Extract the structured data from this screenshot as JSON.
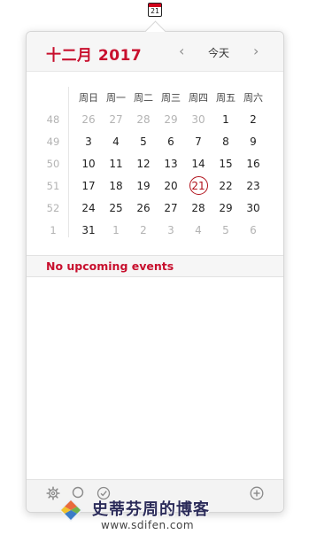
{
  "menubar": {
    "calendar_icon_day": "21"
  },
  "header": {
    "month_title": "十二月 2017",
    "prev_label": "‹",
    "next_label": "›",
    "today_label": "今天"
  },
  "calendar": {
    "weekdays": [
      "周日",
      "周一",
      "周二",
      "周三",
      "周四",
      "周五",
      "周六"
    ],
    "weeks": [
      {
        "week": "48",
        "days": [
          {
            "d": "26",
            "other": true
          },
          {
            "d": "27",
            "other": true
          },
          {
            "d": "28",
            "other": true
          },
          {
            "d": "29",
            "other": true
          },
          {
            "d": "30",
            "other": true
          },
          {
            "d": "1"
          },
          {
            "d": "2"
          }
        ]
      },
      {
        "week": "49",
        "days": [
          {
            "d": "3"
          },
          {
            "d": "4"
          },
          {
            "d": "5"
          },
          {
            "d": "6"
          },
          {
            "d": "7"
          },
          {
            "d": "8"
          },
          {
            "d": "9"
          }
        ]
      },
      {
        "week": "50",
        "days": [
          {
            "d": "10"
          },
          {
            "d": "11"
          },
          {
            "d": "12"
          },
          {
            "d": "13"
          },
          {
            "d": "14"
          },
          {
            "d": "15"
          },
          {
            "d": "16"
          }
        ]
      },
      {
        "week": "51",
        "days": [
          {
            "d": "17"
          },
          {
            "d": "18"
          },
          {
            "d": "19"
          },
          {
            "d": "20"
          },
          {
            "d": "21",
            "today": true
          },
          {
            "d": "22"
          },
          {
            "d": "23"
          }
        ]
      },
      {
        "week": "52",
        "days": [
          {
            "d": "24"
          },
          {
            "d": "25"
          },
          {
            "d": "26"
          },
          {
            "d": "27"
          },
          {
            "d": "28"
          },
          {
            "d": "29"
          },
          {
            "d": "30"
          }
        ]
      },
      {
        "week": "1",
        "days": [
          {
            "d": "31"
          },
          {
            "d": "1",
            "other": true
          },
          {
            "d": "2",
            "other": true
          },
          {
            "d": "3",
            "other": true
          },
          {
            "d": "4",
            "other": true
          },
          {
            "d": "5",
            "other": true
          },
          {
            "d": "6",
            "other": true
          }
        ]
      }
    ]
  },
  "events": {
    "empty_label": "No upcoming events"
  },
  "footer": {
    "icons": [
      "gear-icon",
      "search-icon",
      "checkmark-icon",
      "add-icon"
    ]
  },
  "watermark": {
    "title": "史蒂芬周的博客",
    "url": "www.sdifen.com"
  },
  "colors": {
    "accent": "#c8102e",
    "today_ring": "#b0101a",
    "muted": "#b3b3b3"
  }
}
